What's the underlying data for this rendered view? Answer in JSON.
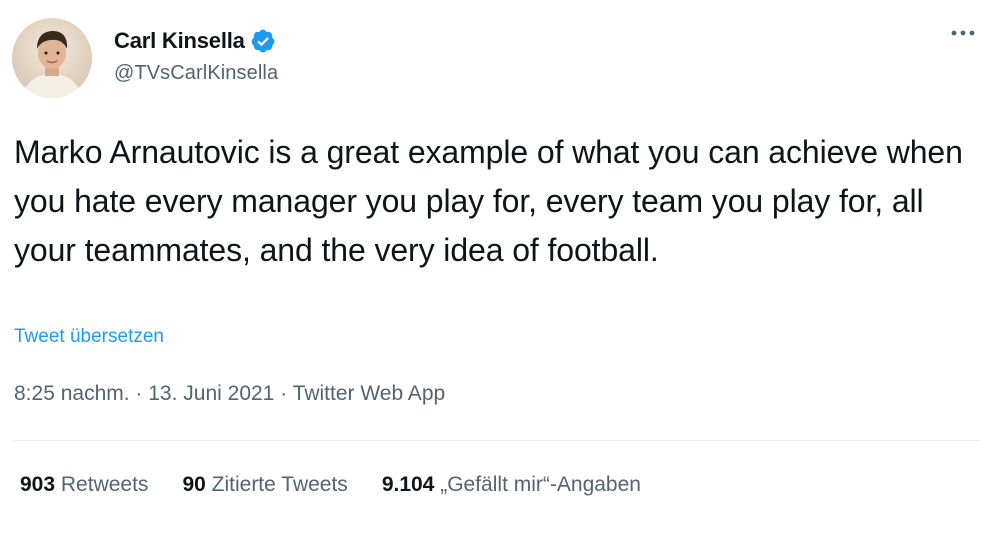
{
  "author": {
    "display_name": "Carl Kinsella",
    "handle": "@TVsCarlKinsella",
    "verified": true
  },
  "icons": {
    "verified": "verified-badge-icon",
    "more": "more-options-icon"
  },
  "tweet": {
    "text": "Marko Arnautovic is a great example of what you can achieve when you hate every manager you play for, every team you play for, all your teammates, and the very idea of football.",
    "translate_label": "Tweet übersetzen"
  },
  "meta": {
    "time": "8:25 nachm.",
    "separator": " · ",
    "date": "13. Juni 2021",
    "source": "Twitter Web App"
  },
  "stats": {
    "retweets": {
      "count": "903",
      "label": "Retweets"
    },
    "quotes": {
      "count": "90",
      "label": "Zitierte Tweets"
    },
    "likes": {
      "count": "9.104",
      "label": "„Gefällt mir“-Angaben"
    }
  },
  "colors": {
    "accent": "#1d9bf0",
    "text": "#0f1419",
    "secondary": "#536471"
  }
}
